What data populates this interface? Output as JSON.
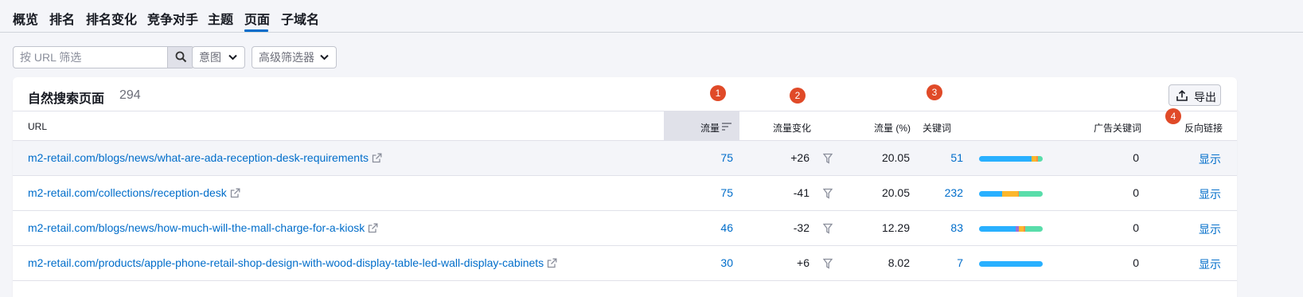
{
  "nav": {
    "tabs": [
      {
        "label": "概览"
      },
      {
        "label": "排名"
      },
      {
        "label": "排名变化"
      },
      {
        "label": "竞争对手"
      },
      {
        "label": "主题"
      },
      {
        "label": "页面"
      },
      {
        "label": "子域名"
      }
    ],
    "active_tab": "页面"
  },
  "filters": {
    "url_placeholder": "按 URL 筛选",
    "intent_label": "意图",
    "advanced_label": "高级筛选器"
  },
  "table": {
    "title": "自然搜索页面",
    "count": "294",
    "export_label": "导出",
    "markers": [
      "1",
      "2",
      "3",
      "4"
    ],
    "columns": {
      "url": "URL",
      "traffic": "流量",
      "traffic_change": "流量变化",
      "traffic_pct": "流量 (%)",
      "keywords": "关键词",
      "ad_keywords": "广告关键词",
      "backlinks": "反向链接"
    },
    "rows": [
      {
        "url": "m2-retail.com/blogs/news/what-are-ada-reception-desk-requirements",
        "traffic": "75",
        "change": "+26",
        "pct": "20.05",
        "keywords": "51",
        "ad_keywords": "0",
        "backlinks": "显示",
        "bar": [
          {
            "color": "#29b0ff",
            "share": 0.82
          },
          {
            "color": "#fcb72c",
            "share": 0.08
          },
          {
            "color": "#ff8c43",
            "share": 0.03
          },
          {
            "color": "#59ddaa",
            "share": 0.07
          }
        ]
      },
      {
        "url": "m2-retail.com/collections/reception-desk",
        "traffic": "75",
        "change": "-41",
        "pct": "20.05",
        "keywords": "232",
        "ad_keywords": "0",
        "backlinks": "显示",
        "bar": [
          {
            "color": "#29b0ff",
            "share": 0.36
          },
          {
            "color": "#fcb72c",
            "share": 0.25
          },
          {
            "color": "#ff8c43",
            "share": 0.02
          },
          {
            "color": "#59ddaa",
            "share": 0.37
          }
        ]
      },
      {
        "url": "m2-retail.com/blogs/news/how-much-will-the-mall-charge-for-a-kiosk",
        "traffic": "46",
        "change": "-32",
        "pct": "12.29",
        "keywords": "83",
        "ad_keywords": "0",
        "backlinks": "显示",
        "bar": [
          {
            "color": "#29b0ff",
            "share": 0.58
          },
          {
            "color": "#9d72d4",
            "share": 0.04
          },
          {
            "color": "#fcb72c",
            "share": 0.08
          },
          {
            "color": "#ff8c43",
            "share": 0.02
          },
          {
            "color": "#59ddaa",
            "share": 0.28
          }
        ]
      },
      {
        "url": "m2-retail.com/products/apple-phone-retail-shop-design-with-wood-display-table-led-wall-display-cabinets",
        "traffic": "30",
        "change": "+6",
        "pct": "8.02",
        "keywords": "7",
        "ad_keywords": "0",
        "backlinks": "显示",
        "bar": [
          {
            "color": "#29b0ff",
            "share": 1.0
          }
        ]
      }
    ]
  },
  "colors": {
    "accent": "#006dca",
    "marker": "#e04a28"
  },
  "icons": [
    "search-icon",
    "chevron-down-icon",
    "export-icon",
    "sort-icon",
    "external-link-icon",
    "filter-icon"
  ]
}
